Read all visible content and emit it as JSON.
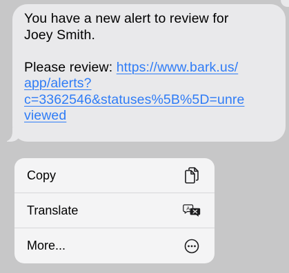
{
  "message": {
    "line1": "You have a new alert to review for",
    "line2": "Joey Smith.",
    "review_prefix": "Please review: ",
    "link_part1": "https://www.bark.us/",
    "link_part2": "app/alerts?",
    "link_part3": "c=3362546&statuses%5B%5D=unre",
    "link_part4": "viewed",
    "link_color": "#2f7cf6",
    "bubble_color": "#e9e9eb"
  },
  "context_menu": {
    "items": [
      {
        "label": "Copy",
        "icon": "copy-icon"
      },
      {
        "label": "Translate",
        "icon": "translate-icon"
      },
      {
        "label": "More...",
        "icon": "more-icon"
      }
    ]
  }
}
